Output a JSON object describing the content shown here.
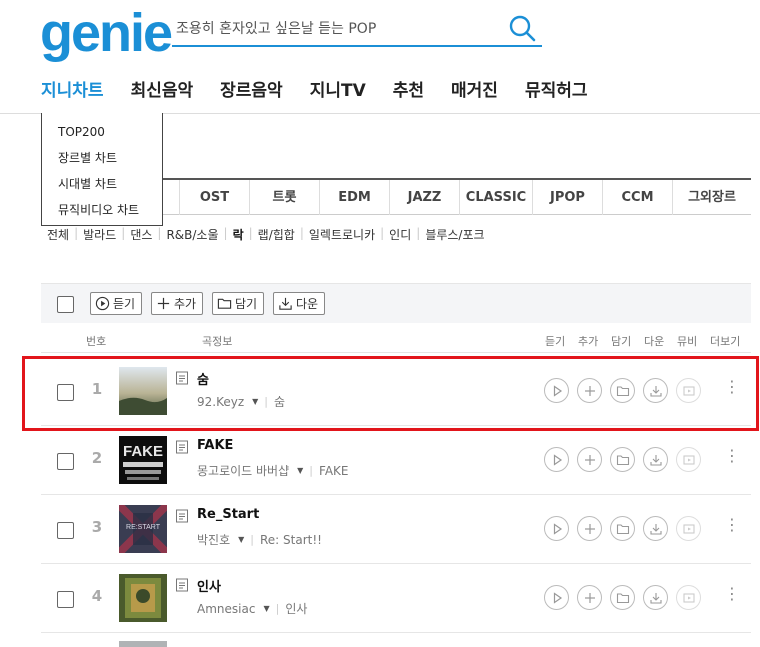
{
  "logo": "genie",
  "search": {
    "value": "조용히 혼자있고 싶은날 듣는 POP"
  },
  "gnb": [
    "지니차트",
    "최신음악",
    "장르음악",
    "지니TV",
    "추천",
    "매거진",
    "뮤직허그"
  ],
  "dropdown": [
    "TOP200",
    "장르별 차트",
    "시대별 차트",
    "뮤직비디오 차트"
  ],
  "genre_tabs": [
    "OST",
    "트롯",
    "EDM",
    "JAZZ",
    "CLASSIC",
    "JPOP",
    "CCM",
    "그외장르"
  ],
  "subgenres": [
    "전체",
    "발라드",
    "댄스",
    "R&B/소울",
    "락",
    "랩/힙합",
    "일렉트로니카",
    "인디",
    "블루스/포크"
  ],
  "active_subgenre": "락",
  "toolbar": {
    "listen": "듣기",
    "add": "추가",
    "save": "담기",
    "download": "다운"
  },
  "list_header": {
    "no": "번호",
    "info": "곡정보",
    "listen": "듣기",
    "add": "추가",
    "save": "담기",
    "down": "다운",
    "mv": "뮤비",
    "more": "더보기"
  },
  "rows": [
    {
      "rank": "1",
      "title": "숨",
      "artist": "92.Keyz",
      "album": "숨"
    },
    {
      "rank": "2",
      "title": "FAKE",
      "artist": "몽고로이드 바버샵",
      "album": "FAKE"
    },
    {
      "rank": "3",
      "title": "Re_Start",
      "artist": "박진호",
      "album": "Re: Start!!"
    },
    {
      "rank": "4",
      "title": "인사",
      "artist": "Amnesiac",
      "album": "인사"
    }
  ],
  "colors": {
    "brand": "#1b8fd6",
    "highlight": "#e2151b"
  }
}
